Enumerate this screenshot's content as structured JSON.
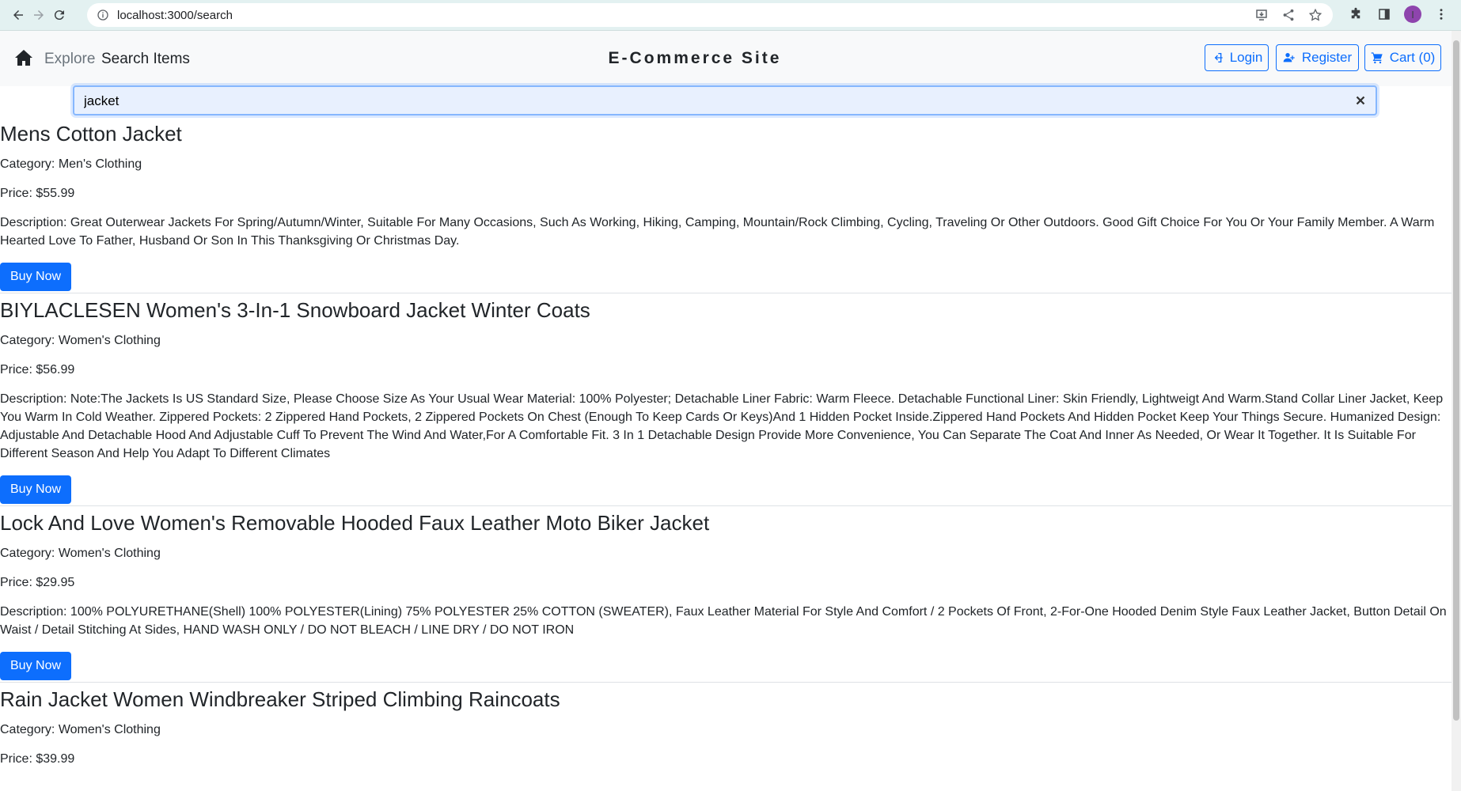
{
  "browser": {
    "url": "localhost:3000/search",
    "avatar_letter": "I"
  },
  "header": {
    "explore": "Explore",
    "search_items": "Search Items",
    "brand": "E-Commerce Site",
    "login": "Login",
    "register": "Register",
    "cart": "Cart (0)"
  },
  "search": {
    "value": "jacket"
  },
  "results": [
    {
      "title": "Mens Cotton Jacket",
      "category": "Category: Men's Clothing",
      "price": "Price: $55.99",
      "description": "Description: Great Outerwear Jackets For Spring/Autumn/Winter, Suitable For Many Occasions, Such As Working, Hiking, Camping, Mountain/Rock Climbing, Cycling, Traveling Or Other Outdoors. Good Gift Choice For You Or Your Family Member. A Warm Hearted Love To Father, Husband Or Son In This Thanksgiving Or Christmas Day.",
      "buy": "Buy Now"
    },
    {
      "title": "BIYLACLESEN Women's 3-In-1 Snowboard Jacket Winter Coats",
      "category": "Category: Women's Clothing",
      "price": "Price: $56.99",
      "description": "Description: Note:The Jackets Is US Standard Size, Please Choose Size As Your Usual Wear Material: 100% Polyester; Detachable Liner Fabric: Warm Fleece. Detachable Functional Liner: Skin Friendly, Lightweigt And Warm.Stand Collar Liner Jacket, Keep You Warm In Cold Weather. Zippered Pockets: 2 Zippered Hand Pockets, 2 Zippered Pockets On Chest (Enough To Keep Cards Or Keys)And 1 Hidden Pocket Inside.Zippered Hand Pockets And Hidden Pocket Keep Your Things Secure. Humanized Design: Adjustable And Detachable Hood And Adjustable Cuff To Prevent The Wind And Water,For A Comfortable Fit. 3 In 1 Detachable Design Provide More Convenience, You Can Separate The Coat And Inner As Needed, Or Wear It Together. It Is Suitable For Different Season And Help You Adapt To Different Climates",
      "buy": "Buy Now"
    },
    {
      "title": "Lock And Love Women's Removable Hooded Faux Leather Moto Biker Jacket",
      "category": "Category: Women's Clothing",
      "price": "Price: $29.95",
      "description": "Description: 100% POLYURETHANE(Shell) 100% POLYESTER(Lining) 75% POLYESTER 25% COTTON (SWEATER), Faux Leather Material For Style And Comfort / 2 Pockets Of Front, 2-For-One Hooded Denim Style Faux Leather Jacket, Button Detail On Waist / Detail Stitching At Sides, HAND WASH ONLY / DO NOT BLEACH / LINE DRY / DO NOT IRON",
      "buy": "Buy Now"
    },
    {
      "title": "Rain Jacket Women Windbreaker Striped Climbing Raincoats",
      "category": "Category: Women's Clothing",
      "price": "Price: $39.99"
    }
  ]
}
